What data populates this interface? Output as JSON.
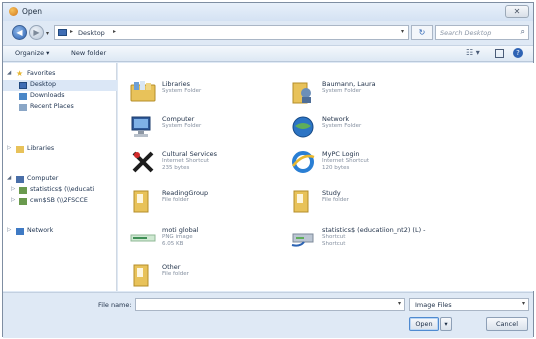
{
  "window": {
    "title": "Open",
    "close_glyph": "✕"
  },
  "address": {
    "location": "Desktop",
    "search_placeholder": "Search Desktop",
    "back_glyph": "◀",
    "forward_glyph": "▶",
    "refresh_glyph": "↻"
  },
  "toolbar": {
    "organize_label": "Organize ▾",
    "new_folder_label": "New folder",
    "views_glyph": "☷ ▾",
    "help_glyph": "?"
  },
  "sidebar": {
    "favorites": "Favorites",
    "desktop": "Desktop",
    "downloads": "Downloads",
    "recent_places": "Recent Places",
    "libraries": "Libraries",
    "computer": "Computer",
    "drive1": "statistics$ (\\\\educati",
    "drive2": "cwn$SB (\\\\2FSCCE",
    "network": "Network"
  },
  "files": [
    {
      "name": "Libraries",
      "sub": "System Folder",
      "sub2": "",
      "icon": "libraries-icon"
    },
    {
      "name": "Baumann, Laura",
      "sub": "System Folder",
      "sub2": "",
      "icon": "user-folder-icon"
    },
    {
      "name": "Computer",
      "sub": "System Folder",
      "sub2": "",
      "icon": "computer-icon"
    },
    {
      "name": "Network",
      "sub": "System Folder",
      "sub2": "",
      "icon": "network-icon"
    },
    {
      "name": "Cultural Services",
      "sub": "Internet Shortcut",
      "sub2": "235 bytes",
      "icon": "shortcut-icon"
    },
    {
      "name": "MyPC Login",
      "sub": "Internet Shortcut",
      "sub2": "120 bytes",
      "icon": "ie-icon"
    },
    {
      "name": "ReadingGroup",
      "sub": "File folder",
      "sub2": "",
      "icon": "folder-icon"
    },
    {
      "name": "Study",
      "sub": "File folder",
      "sub2": "",
      "icon": "folder-icon"
    },
    {
      "name": "moti global",
      "sub": "PNG image",
      "sub2": "6.05 KB",
      "icon": "image-icon"
    },
    {
      "name": "statistics$ (educatiion_nt2) (L) -",
      "sub": "Shortcut",
      "sub2": "Shortcut",
      "icon": "drive-shortcut-icon"
    },
    {
      "name": "Other",
      "sub": "File folder",
      "sub2": "",
      "icon": "folder-icon"
    }
  ],
  "bottom": {
    "file_name_label": "File name:",
    "file_name_value": "",
    "file_type": "Image Files",
    "open_label": "Open",
    "cancel_label": "Cancel"
  },
  "colors": {
    "accent": "#2e63b4",
    "folder": "#e8c25a",
    "chrome": "#dfe9f5"
  }
}
